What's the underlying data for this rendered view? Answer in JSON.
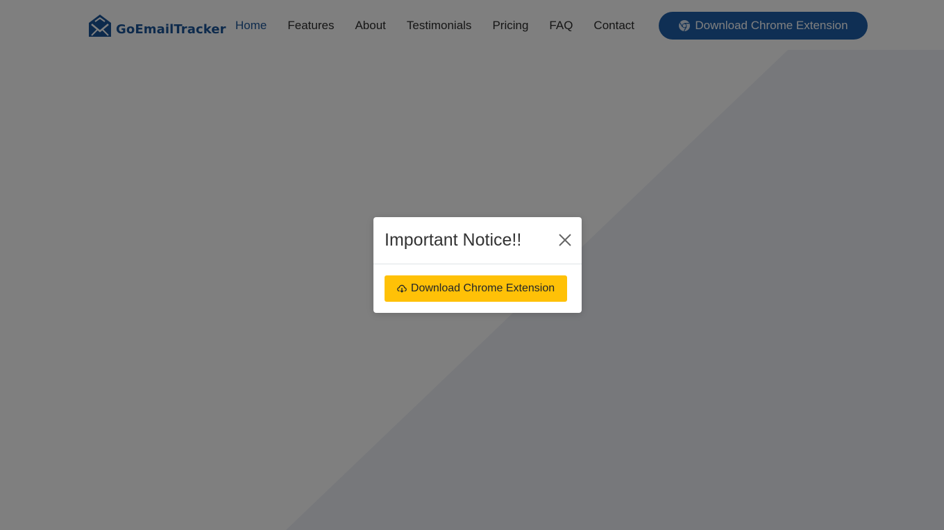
{
  "brand": {
    "name": "GoEmailTracker",
    "color": "#1a5599"
  },
  "nav": {
    "items": [
      {
        "label": "Home",
        "active": true
      },
      {
        "label": "Features",
        "active": false
      },
      {
        "label": "About",
        "active": false
      },
      {
        "label": "Testimonials",
        "active": false
      },
      {
        "label": "Pricing",
        "active": false
      },
      {
        "label": "FAQ",
        "active": false
      },
      {
        "label": "Contact",
        "active": false
      }
    ],
    "cta_label": "Download Chrome Extension",
    "cta_icon": "chrome-icon",
    "cta_color": "#1f5fa8"
  },
  "modal": {
    "title": "Important Notice!!",
    "close_icon": "close-icon",
    "button_label": "Download Chrome Extension",
    "button_icon": "cloud-download-icon",
    "button_color": "#ffc107"
  },
  "colors": {
    "overlay": "rgba(0,0,0,0.5)",
    "hero_diagonal": "#eef1f7"
  }
}
